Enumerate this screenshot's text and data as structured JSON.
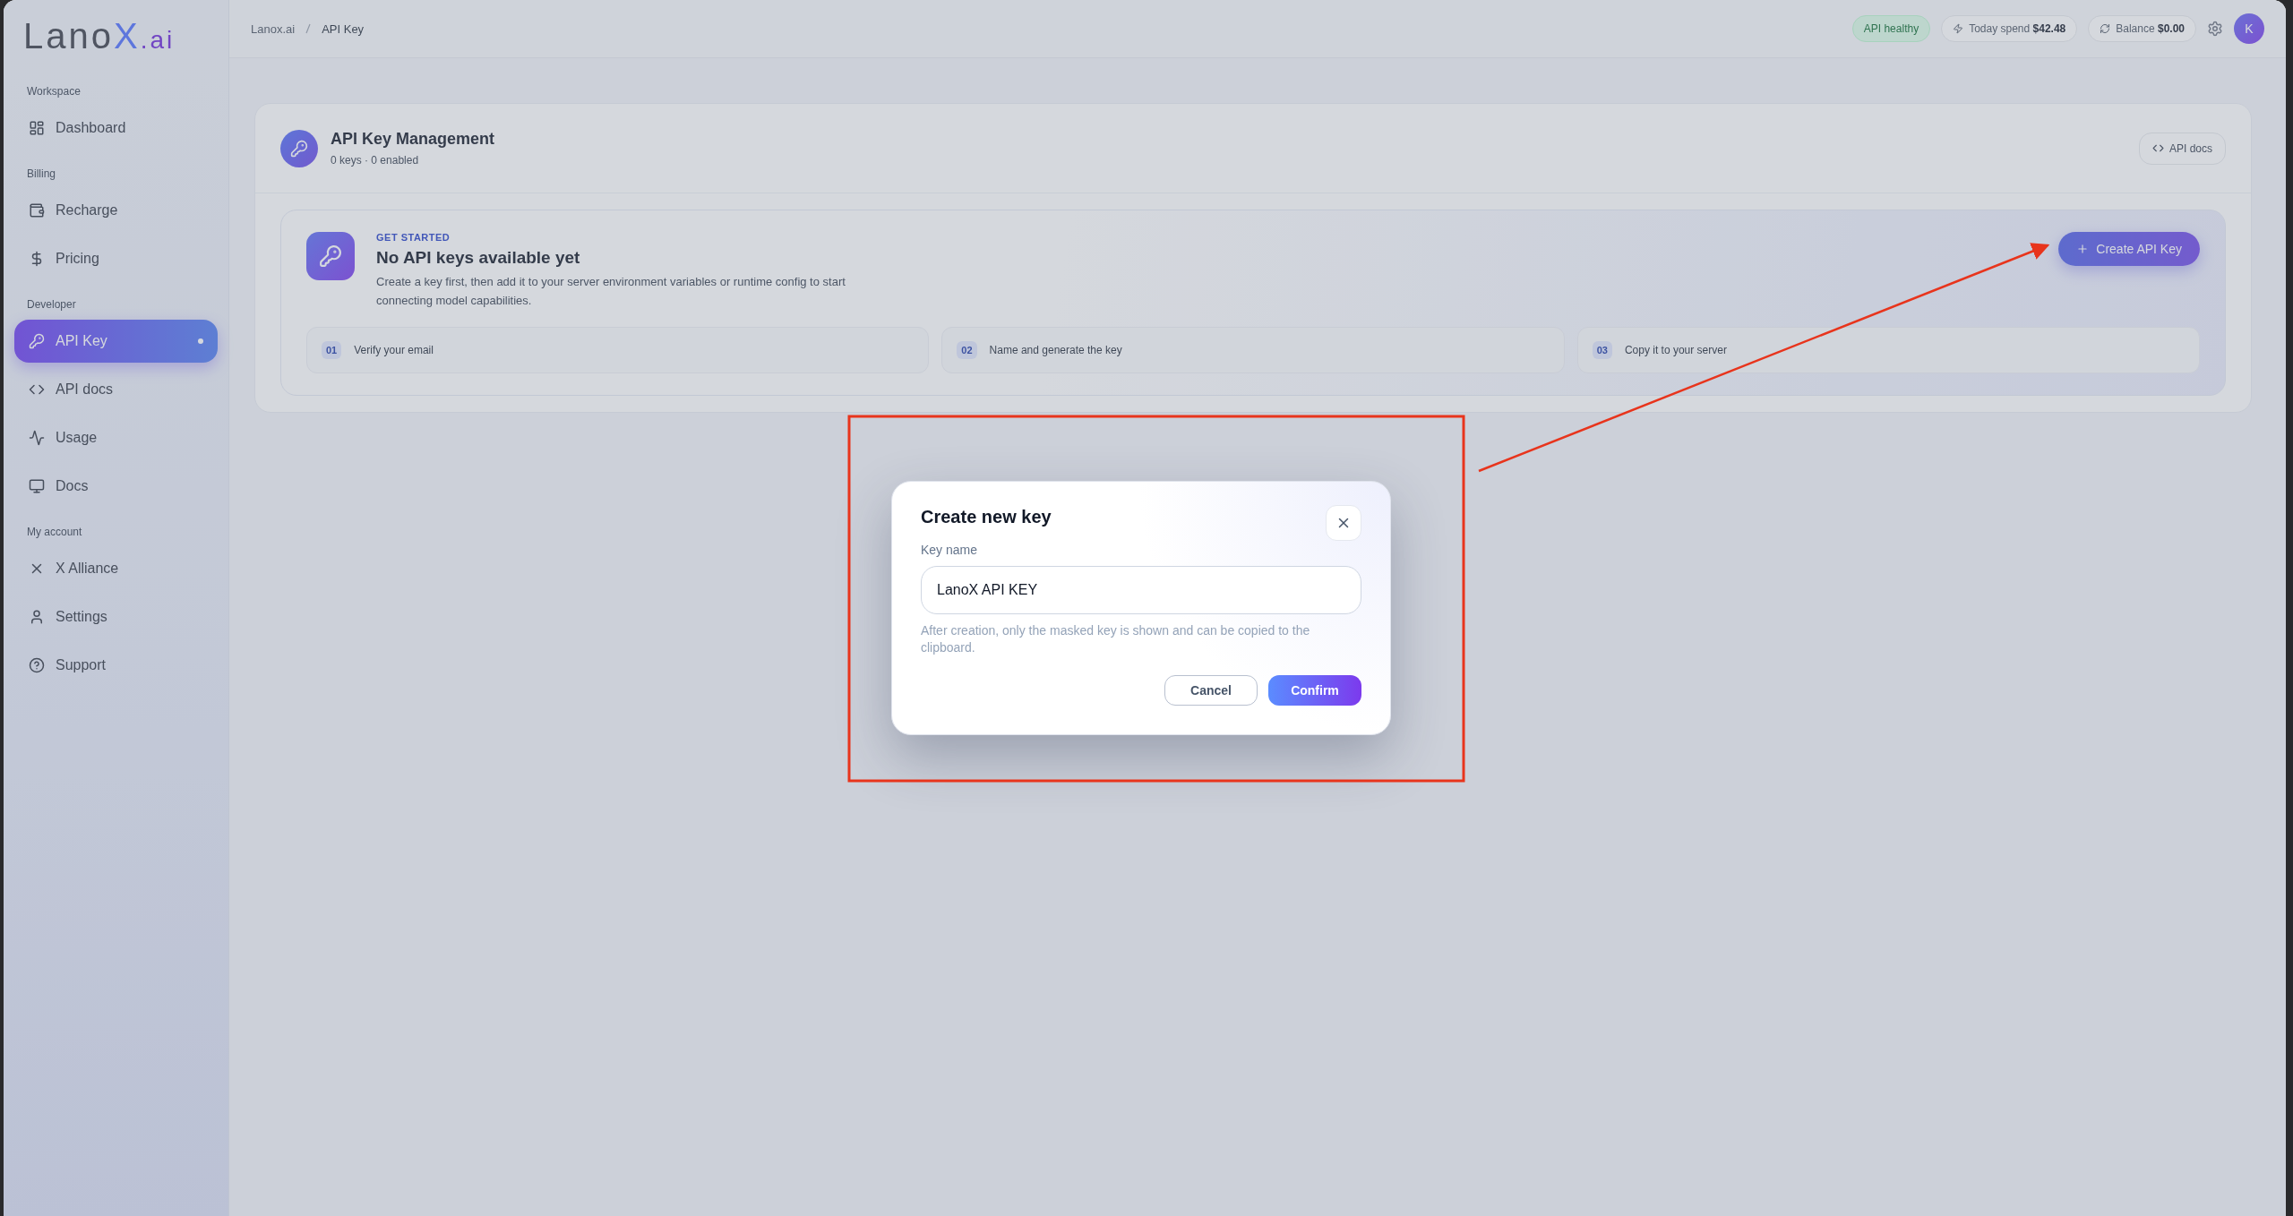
{
  "sidebar": {
    "logo": {
      "main": "Lano",
      "accent": "X",
      "suffix": ".ai"
    },
    "sections": [
      {
        "label": "Workspace",
        "items": [
          {
            "label": "Dashboard",
            "selected": false
          }
        ]
      },
      {
        "label": "Billing",
        "items": [
          {
            "label": "Recharge",
            "selected": false
          },
          {
            "label": "Pricing",
            "selected": false
          }
        ]
      },
      {
        "label": "Developer",
        "items": [
          {
            "label": "API Key",
            "selected": true
          },
          {
            "label": "API docs",
            "selected": false
          },
          {
            "label": "Usage",
            "selected": false
          },
          {
            "label": "Docs",
            "selected": false
          }
        ]
      },
      {
        "label": "My account",
        "items": [
          {
            "label": "X Alliance",
            "selected": false
          },
          {
            "label": "Settings",
            "selected": false
          },
          {
            "label": "Support",
            "selected": false
          }
        ]
      }
    ]
  },
  "topbar": {
    "breadcrumb": [
      "Lanox.ai",
      "API Key"
    ],
    "status": "API healthy",
    "spend": {
      "label": "Today spend",
      "value": "$42.48"
    },
    "balance": {
      "label": "Balance",
      "value": "$0.00"
    },
    "avatar": "K"
  },
  "page": {
    "title": "API Key Management",
    "subtitle": "0 keys · 0 enabled",
    "docs_button": "API docs",
    "empty_state": {
      "eyebrow": "GET STARTED",
      "title": "No API keys available yet",
      "description": "Create a key first, then add it to your server environment variables or runtime config to start connecting model capabilities.",
      "create_button": "Create API Key",
      "steps": [
        {
          "number": "01",
          "label": "Verify your email"
        },
        {
          "number": "02",
          "label": "Name and generate the key"
        },
        {
          "number": "03",
          "label": "Copy it to your server"
        }
      ]
    }
  },
  "dialog": {
    "title": "Create new key",
    "field_label": "Key name",
    "value": "LanoX API KEY",
    "hint": "After creation, only the masked key is shown and can be copied to the clipboard.",
    "cancel": "Cancel",
    "confirm": "Confirm"
  }
}
